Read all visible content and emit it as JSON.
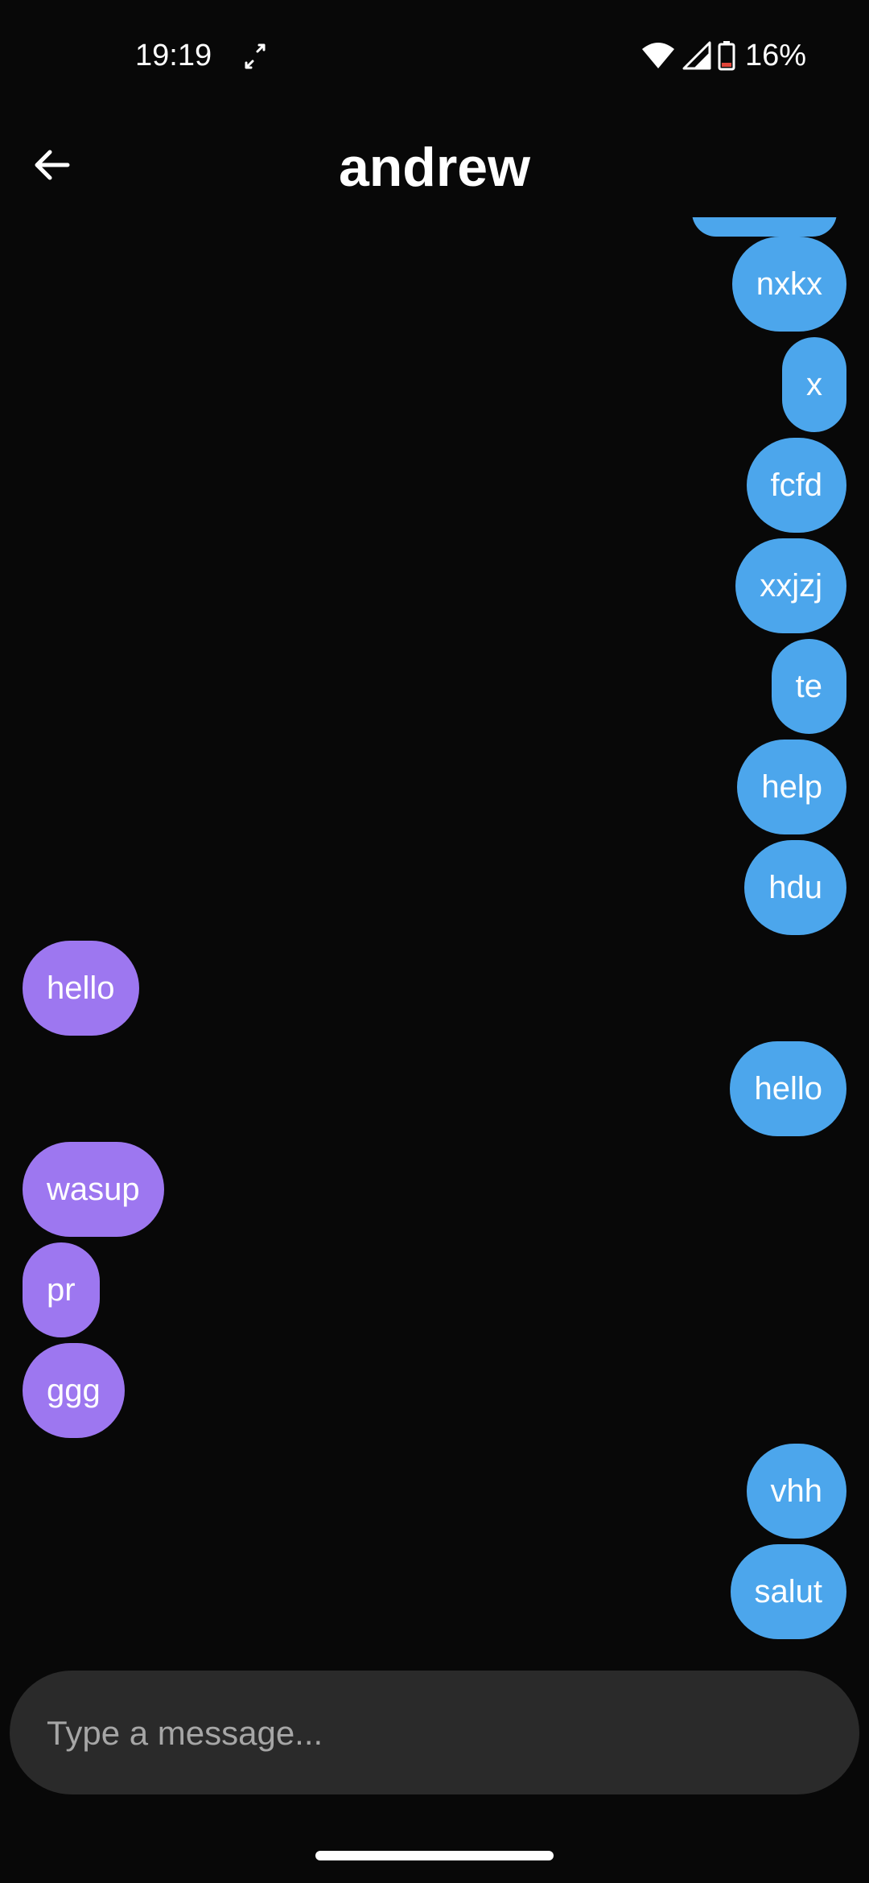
{
  "status_bar": {
    "time": "19:19",
    "battery": "16%",
    "icons": [
      "sync-icon",
      "wifi-icon",
      "signal-icon",
      "battery-icon"
    ],
    "battery_level": 0.16
  },
  "header": {
    "back_icon": "arrow-left-icon",
    "title": "andrew"
  },
  "messages": [
    {
      "text": "nxkx",
      "from": "me"
    },
    {
      "text": "x",
      "from": "me"
    },
    {
      "text": "fcfd",
      "from": "me"
    },
    {
      "text": "xxjzj",
      "from": "me"
    },
    {
      "text": "te",
      "from": "me"
    },
    {
      "text": "help",
      "from": "me"
    },
    {
      "text": "hdu",
      "from": "me"
    },
    {
      "text": "hello",
      "from": "them"
    },
    {
      "text": "hello",
      "from": "me"
    },
    {
      "text": "wasup",
      "from": "them"
    },
    {
      "text": "pr",
      "from": "them"
    },
    {
      "text": "ggg",
      "from": "them"
    },
    {
      "text": "vhh",
      "from": "me"
    },
    {
      "text": "salut",
      "from": "me"
    }
  ],
  "composer": {
    "placeholder": "Type a message..."
  },
  "colors": {
    "background": "#080808",
    "sent_bubble": "#4ca6ec",
    "received_bubble": "#9d77f0",
    "composer_bg": "#2a2a2a",
    "battery_low": "#e0453a"
  }
}
